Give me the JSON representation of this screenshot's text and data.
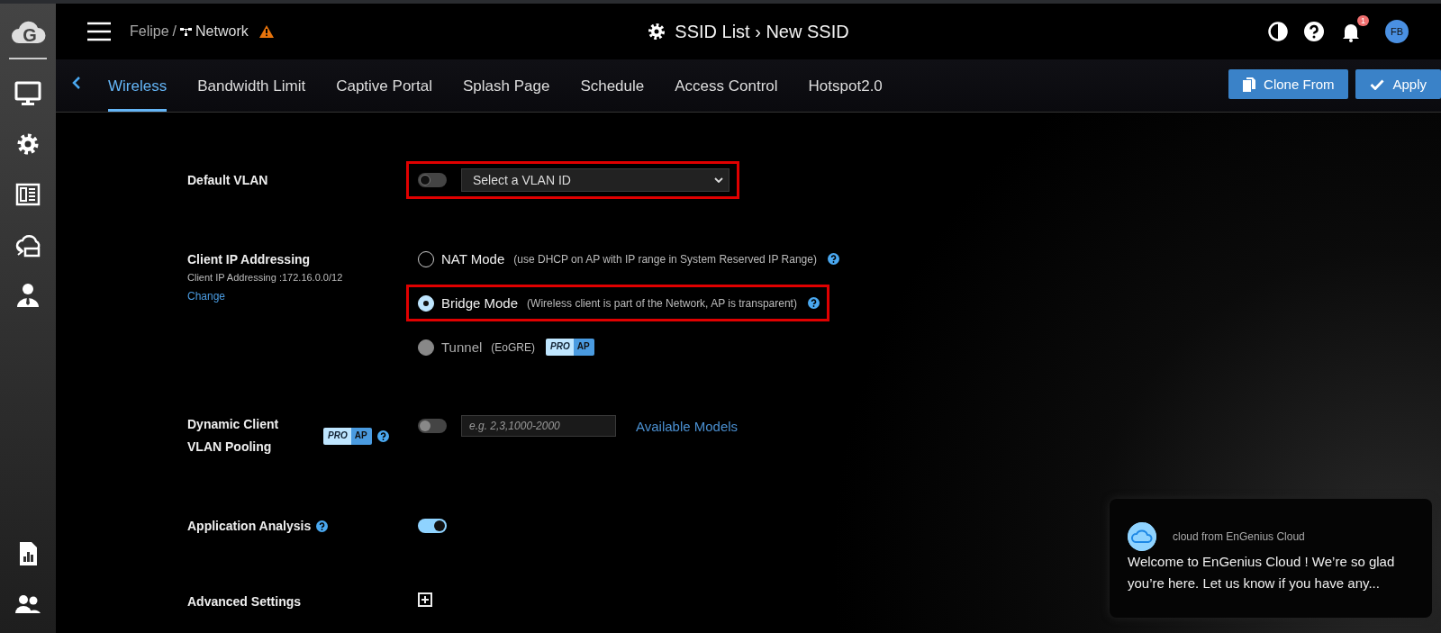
{
  "sidebar": {
    "logo_letter": "G"
  },
  "header": {
    "org": "Felipe",
    "separator": "/",
    "network": "Network",
    "warning": true,
    "title": "SSID List › New SSID",
    "notification_count": "1",
    "avatar": "FB"
  },
  "tabs": [
    {
      "label": "Wireless",
      "selected": true
    },
    {
      "label": "Bandwidth Limit",
      "selected": false
    },
    {
      "label": "Captive Portal",
      "selected": false
    },
    {
      "label": "Splash Page",
      "selected": false
    },
    {
      "label": "Schedule",
      "selected": false
    },
    {
      "label": "Access Control",
      "selected": false
    },
    {
      "label": "Hotspot2.0",
      "selected": false
    }
  ],
  "buttons": [
    {
      "kind": "clone",
      "label": "Clone From"
    },
    {
      "kind": "apply",
      "label": "Apply"
    }
  ],
  "settings": [
    {
      "kind": "vlan",
      "label": "Default VLAN",
      "on": false,
      "select": "Select a VLAN ID",
      "highlighted": true
    },
    {
      "kind": "radio",
      "label": "Client IP Addressing",
      "sublabel": "Client IP Addressing :172.16.0.0/12",
      "link": "Change",
      "options": [
        {
          "label": "NAT Mode",
          "note": "(use DHCP on AP with IP range in System Reserved IP Range)",
          "selected": false,
          "disabled": false,
          "help": true,
          "highlighted": false
        },
        {
          "label": "Bridge Mode",
          "note": "(Wireless client is part of the Network, AP is transparent)",
          "selected": true,
          "disabled": false,
          "help": true,
          "highlighted": true
        },
        {
          "label": "Tunnel",
          "note": "(EoGRE)",
          "selected": false,
          "disabled": true,
          "highlighted": false,
          "badge": [
            "PRO",
            "AP"
          ]
        }
      ]
    },
    {
      "kind": "pooling",
      "label": "Dynamic Client VLAN Pooling",
      "badge": [
        "PRO",
        "AP"
      ],
      "help": true,
      "on": false,
      "placeholder": "e.g. 2,3,1000-2000",
      "link": "Available Models"
    },
    {
      "kind": "toggle",
      "label": "Application Analysis",
      "help": true,
      "on": true
    },
    {
      "kind": "expand",
      "label": "Advanced Settings",
      "expanded": false
    }
  ],
  "chat": {
    "sender": "cloud from EnGenius Cloud",
    "message": "Welcome to EnGenius Cloud ! We’re so glad you’re here. Let us know if you have any..."
  }
}
